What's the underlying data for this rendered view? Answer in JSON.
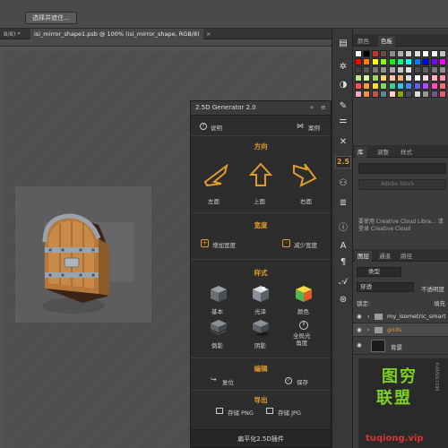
{
  "option_bar": {
    "select_label": "选择并遮住..."
  },
  "doc_tabs": [
    {
      "label": "B/8) *"
    },
    {
      "label": "isi_mirror_shape1.psb @ 100% (isi_mirror_shape, RGB/8)"
    },
    {
      "label": "×"
    }
  ],
  "plugin": {
    "title": "2.5D Generator 2.0",
    "help_label": "说明",
    "cases_label": "案例",
    "direction": {
      "title": "方向",
      "left": "左面",
      "top": "上面",
      "right": "右面"
    },
    "width": {
      "title": "宽度",
      "add": "增加宽度",
      "reduce": "减少宽度"
    },
    "style": {
      "title": "样式",
      "items": [
        "基本",
        "光泽",
        "颜色",
        "倒影",
        "阴影",
        "全局光\n角度"
      ]
    },
    "edit": {
      "title": "编辑",
      "reset": "复位",
      "save": "保存"
    },
    "export": {
      "title": "导出",
      "png": "存储 PNG",
      "jpg": "存储 JPG"
    },
    "footer": "扁平化2.5D插件"
  },
  "tools": {
    "badge": "2.5"
  },
  "right_panel": {
    "swatch_tabs": [
      "颜色",
      "色板"
    ],
    "swatch_colors": [
      "#ffffff",
      "#000000",
      "#c0392b",
      "#6d4c41",
      "#8e8e8e",
      "#b0b0b0",
      "#d0d0d0",
      "#e0e0e0",
      "#ffffff",
      "#f2f2f2",
      "#c0c0c0",
      "#ff0000",
      "#ff8000",
      "#ffff00",
      "#80ff00",
      "#00ff00",
      "#00ff80",
      "#00ffff",
      "#0080ff",
      "#0000ff",
      "#8000ff",
      "#ff00ff",
      "#3d3d3d",
      "#5a5a5a",
      "#777777",
      "#939393",
      "#adadad",
      "#c8c8c8",
      "#e2e2e2",
      "#4a4a4a",
      "#606060",
      "#787878",
      "#909090",
      "#b8e986",
      "#d3f5a8",
      "#a0d468",
      "#ffd166",
      "#ffcba4",
      "#f7b267",
      "#e0e0e0",
      "#ffffff",
      "#ffd6e0",
      "#ffb3c1",
      "#ff8fa3",
      "#ff4d4d",
      "#ff9a3c",
      "#ffdd33",
      "#7ed957",
      "#3ccf91",
      "#32c5e0",
      "#3c8dff",
      "#6a5cff",
      "#b44dff",
      "#ff4dc4",
      "#ff6b6b",
      "#f7a8b8",
      "#f28f3b",
      "#c8553d",
      "#588b8b",
      "#ffd5c2",
      "#8ea604",
      "#435058",
      "#dcdcdc",
      "#999999",
      "#7a5195",
      "#ef5675"
    ],
    "library_tabs": [
      "库",
      "调整",
      "样式"
    ],
    "library_search": "Adobe Stock",
    "library_note": "要使用 Creative Cloud Libra... 请登录 Creative Cloud",
    "layers_tabs": [
      "图层",
      "通道",
      "路径"
    ],
    "layers_filter": "类型",
    "blend_mode": "穿透",
    "opacity_label": "不透明度",
    "lock_label": "锁定:",
    "fill_label": "填充",
    "layers": [
      {
        "name": "my_isometric_smart"
      },
      {
        "name": "grids"
      },
      {
        "name": "背景"
      }
    ]
  },
  "watermark": {
    "line1": "图穷",
    "line2": "联盟",
    "side": "XURISN.COM",
    "url": "tuqiong.vip"
  },
  "colors": {
    "accent": "#e09a2d",
    "panel": "#2d2d2d"
  }
}
